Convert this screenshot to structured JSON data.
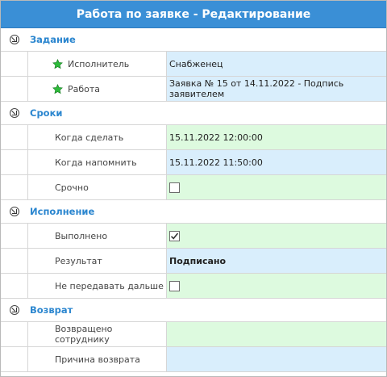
{
  "window": {
    "title": "Работа по заявке - Редактирование"
  },
  "groups": [
    {
      "title": "Задание",
      "rows": [
        {
          "label": "Исполнитель",
          "value": "Снабженец"
        },
        {
          "label": "Работа",
          "value": "Заявка № 15 от 14.11.2022 - Подпись заявителем"
        }
      ]
    },
    {
      "title": "Сроки",
      "rows": [
        {
          "label": "Когда сделать",
          "value": "15.11.2022 12:00:00"
        },
        {
          "label": "Когда напомнить",
          "value": "15.11.2022 11:50:00"
        },
        {
          "label": "Срочно",
          "checked": false
        }
      ]
    },
    {
      "title": "Исполнение",
      "rows": [
        {
          "label": "Выполнено",
          "checked": true
        },
        {
          "label": "Результат",
          "value": "Подписано"
        },
        {
          "label": "Не передавать дальше",
          "checked": false
        }
      ]
    },
    {
      "title": "Возврат",
      "rows": [
        {
          "label": "Возвращено сотруднику",
          "value": ""
        },
        {
          "label": "Причина возврата",
          "value": ""
        }
      ]
    }
  ],
  "colors": {
    "title_bar": "#3a8fd6",
    "group_title": "#2b86cf",
    "field_blue": "#d9eefc",
    "field_green": "#ddfadf",
    "required_star": "#2dbb3a"
  },
  "icons": {
    "required": "star-icon",
    "collapse": "collapse-arrow-icon",
    "checkmark": "checkmark-icon"
  }
}
